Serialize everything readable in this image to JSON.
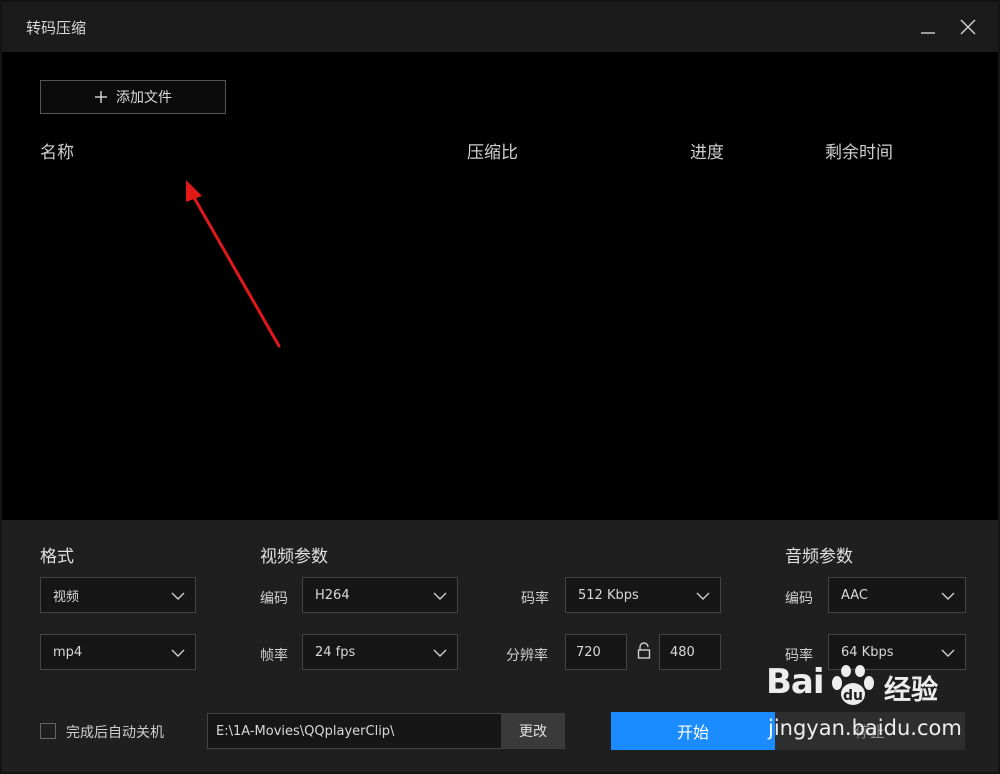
{
  "window": {
    "title": "转码压缩"
  },
  "file_list": {
    "add_button_label": "添加文件",
    "columns": [
      "名称",
      "压缩比",
      "进度",
      "剩余时间"
    ]
  },
  "format": {
    "title": "格式",
    "type_value": "视频",
    "container_value": "mp4"
  },
  "video": {
    "title": "视频参数",
    "codec_label": "编码",
    "codec_value": "H264",
    "framerate_label": "帧率",
    "framerate_value": "24 fps",
    "bitrate_label": "码率",
    "bitrate_value": "512 Kbps",
    "resolution_label": "分辨率",
    "resolution_width": "720",
    "resolution_height": "480"
  },
  "audio": {
    "title": "音频参数",
    "codec_label": "编码",
    "codec_value": "AAC",
    "bitrate_label": "码率",
    "bitrate_value": "64 Kbps"
  },
  "footer": {
    "auto_shutdown_label": "完成后自动关机",
    "output_path": "E:\\1A-Movies\\QQplayerClip\\",
    "change_button_label": "更改",
    "start_button_label": "开始",
    "stop_button_label": "停止"
  },
  "watermark": {
    "logo_text": "Bai",
    "logo_cn": "经验",
    "url": "jingyan.baidu.com"
  },
  "colors": {
    "accent": "#1a8cff",
    "annotation_arrow": "#e01818"
  }
}
